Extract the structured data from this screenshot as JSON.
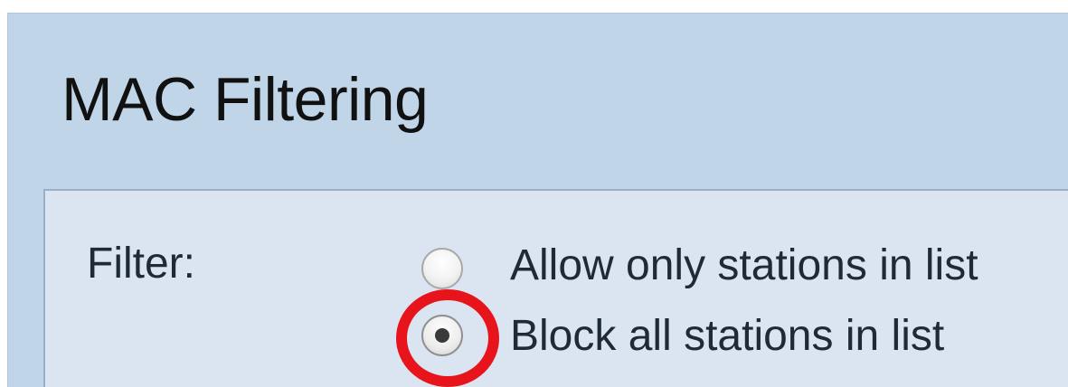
{
  "page": {
    "title": "MAC Filtering"
  },
  "filter": {
    "label": "Filter:",
    "options": [
      {
        "label": "Allow only stations in list",
        "selected": false
      },
      {
        "label": "Block all stations in list",
        "selected": true
      }
    ]
  },
  "annotation": {
    "highlight_color": "#e8141c",
    "highlighted_option": "Block all stations in list"
  }
}
